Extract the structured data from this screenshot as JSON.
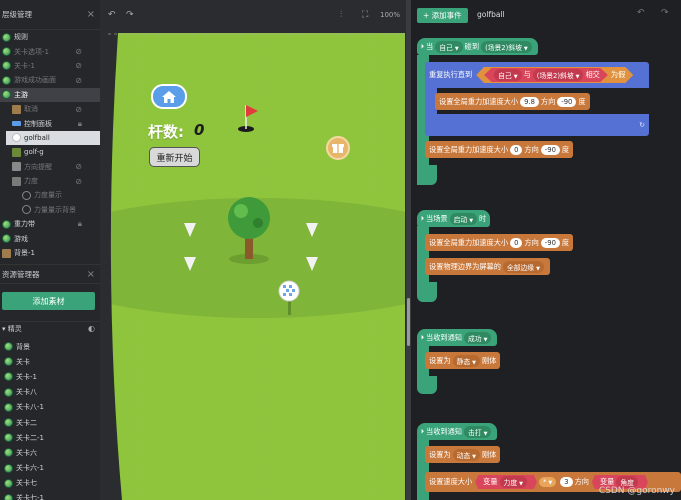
{
  "layers_panel": {
    "title": "层级管理",
    "items": [
      {
        "label": "规则",
        "indent": 0,
        "icon": "globe",
        "state": "normal",
        "tail": ""
      },
      {
        "label": "关卡选项-1",
        "indent": 0,
        "icon": "globe",
        "state": "dim",
        "tail": "eye-off"
      },
      {
        "label": "关卡-1",
        "indent": 0,
        "icon": "globe",
        "state": "dim",
        "tail": "eye-off"
      },
      {
        "label": "游戏成功画面",
        "indent": 0,
        "icon": "globe",
        "state": "dim",
        "tail": "eye-off"
      },
      {
        "label": "主游",
        "indent": 0,
        "icon": "globe",
        "state": "selected",
        "tail": ""
      },
      {
        "label": "取消",
        "indent": 1,
        "icon": "image",
        "state": "dim",
        "tail": "eye-off"
      },
      {
        "label": "控制面板",
        "indent": 1,
        "icon": "panel",
        "state": "normal",
        "tail": "lock"
      },
      {
        "label": "golfball",
        "indent": 1,
        "icon": "ball",
        "state": "highlight",
        "tail": ""
      },
      {
        "label": "golf-g",
        "indent": 1,
        "icon": "flag",
        "state": "normal",
        "tail": ""
      },
      {
        "label": "方向提醒",
        "indent": 1,
        "icon": "arrow",
        "state": "dim",
        "tail": "eye-off"
      },
      {
        "label": "力度",
        "indent": 1,
        "icon": "group",
        "state": "dim",
        "tail": "eye-off"
      },
      {
        "label": "力度量示",
        "indent": 2,
        "icon": "ring",
        "state": "dim",
        "tail": ""
      },
      {
        "label": "力量量示背景",
        "indent": 2,
        "icon": "ring",
        "state": "dim",
        "tail": ""
      },
      {
        "label": "重力带",
        "indent": 0,
        "icon": "globe",
        "state": "normal",
        "tail": "lock"
      },
      {
        "label": "游戏",
        "indent": 0,
        "icon": "globe",
        "state": "normal",
        "tail": ""
      },
      {
        "label": "背景-1",
        "indent": 0,
        "icon": "image",
        "state": "normal",
        "tail": ""
      }
    ]
  },
  "assets_panel": {
    "title": "资源管理器",
    "add_button": "添加素材",
    "sprites_label": "精灵",
    "sprites": [
      "背景",
      "关卡",
      "关卡-1",
      "关卡八",
      "关卡八-1",
      "关卡二",
      "关卡二-1",
      "关卡六",
      "关卡六-1",
      "关卡七",
      "关卡七-1"
    ]
  },
  "stage_toolbar": {
    "zoom": "100%"
  },
  "stage": {
    "strokes_label": "杆数:",
    "strokes_value": "0",
    "restart_button": "重新开始",
    "colors": {
      "grass_light": "#8fc43d",
      "grass_dark": "#7fb538",
      "background": "#2b2c30"
    }
  },
  "events_panel": {
    "add_event_button": "+ 添加事件",
    "object_name": "golfball",
    "blocks": {
      "b1_when": "当",
      "b1_obj": "自己",
      "b1_collide": "碰到",
      "b1_target": "(场景2)斜坡",
      "b2_repeat": "重复执行直到",
      "b2_self": "自己",
      "b2_and": "与",
      "b2_target": "(场景2)斜坡",
      "b2_intersect": "相交",
      "b2_is": "为假",
      "b3_set_gravity": "设置全局重力加速度大小",
      "b3_mag": "9.8",
      "b3_dir": "方向",
      "b3_angle": "-90",
      "b3_deg": "度",
      "b4_set_gravity": "设置全局重力加速度大小",
      "b4_mag": "0",
      "b4_dir": "方向",
      "b4_angle": "-90",
      "b4_deg": "度",
      "b5_when_scene": "当场景",
      "b5_start": "启动",
      "b5_time": "时",
      "b6_set_gravity": "设置全局重力加速度大小",
      "b6_mag": "0",
      "b6_dir": "方向",
      "b6_angle": "-90",
      "b6_deg": "度",
      "b7_set_boundary": "设置物理边界为屏幕的",
      "b7_edges": "全部边缘",
      "b8_when_notify": "当收到通知",
      "b8_msg": "成功",
      "b9_set": "设置为",
      "b9_mode": "静态",
      "b9_body": "刚体",
      "b10_when_notify": "当收到通知",
      "b10_msg": "击打",
      "b11_set": "设置为",
      "b11_mode": "动态",
      "b11_body": "刚体",
      "b12_set_speed": "设置速度大小",
      "b12_var": "变量",
      "b12_var_name": "力度",
      "b12_op": "*",
      "b12_num": "3",
      "b12_dir": "方向",
      "b12_var2": "变量",
      "b12_var2_name": "角度"
    }
  },
  "watermark": "CSDN @goronwy"
}
